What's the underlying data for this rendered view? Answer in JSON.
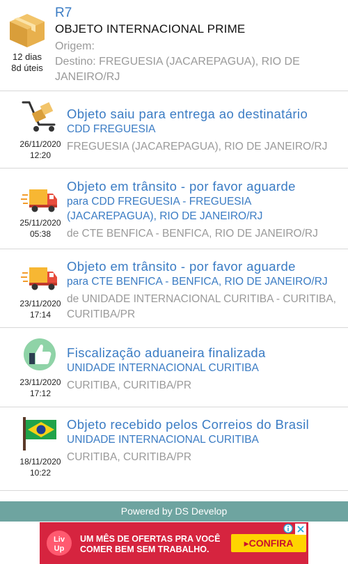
{
  "package": {
    "code": "R7",
    "service": "OBJETO INTERNACIONAL PRIME",
    "days": "12 dias",
    "business_days": "8d úteis",
    "origin": "Origem:",
    "destination": "Destino: FREGUESIA (JACAREPAGUA), RIO DE JANEIRO/RJ",
    "icon": "package-icon"
  },
  "events": [
    {
      "icon": "delivery-cart-icon",
      "date": "26/11/2020",
      "time": "12:20",
      "title": "Objeto saiu para entrega ao destinatário",
      "sub": "CDD FREGUESIA",
      "loc": "FREGUESIA (JACAREPAGUA), RIO DE JANEIRO/RJ"
    },
    {
      "icon": "truck-icon",
      "date": "25/11/2020",
      "time": "05:38",
      "title": "Objeto em trânsito - por favor aguarde",
      "sub": "para CDD FREGUESIA - FREGUESIA (JACAREPAGUA), RIO DE JANEIRO/RJ",
      "loc": "de CTE BENFICA - BENFICA, RIO DE JANEIRO/RJ"
    },
    {
      "icon": "truck-icon",
      "date": "23/11/2020",
      "time": "17:14",
      "title": "Objeto em trânsito - por favor aguarde",
      "sub": "para CTE BENFICA - BENFICA, RIO DE JANEIRO/RJ",
      "loc": "de UNIDADE INTERNACIONAL CURITIBA - CURITIBA, CURITIBA/PR"
    },
    {
      "icon": "thumbs-up-icon",
      "date": "23/11/2020",
      "time": "17:12",
      "title": "Fiscalização aduaneira finalizada",
      "sub": "UNIDADE INTERNACIONAL CURITIBA",
      "loc": "CURITIBA, CURITIBA/PR"
    },
    {
      "icon": "brazil-flag-icon",
      "date": "18/11/2020",
      "time": "10:22",
      "title": "Objeto recebido pelos Correios do Brasil",
      "sub": "UNIDADE INTERNACIONAL CURITIBA",
      "loc": "CURITIBA, CURITIBA/PR"
    }
  ],
  "footer": {
    "powered_by": "Powered by DS Develop"
  },
  "ad": {
    "brand": "Liv Up",
    "line1": "UM MÊS DE OFERTAS PRA VOCÊ",
    "line2": "COMER BEM SEM TRABALHO.",
    "cta": "CONFIRA",
    "info_icon": "info-icon",
    "close_icon": "close-icon"
  },
  "colors": {
    "accent": "#3b7cc4",
    "muted": "#9a9a9a",
    "footer_bg": "#6ea4a0",
    "ad_bg": "#d6243f",
    "ad_cta": "#ffd400"
  }
}
